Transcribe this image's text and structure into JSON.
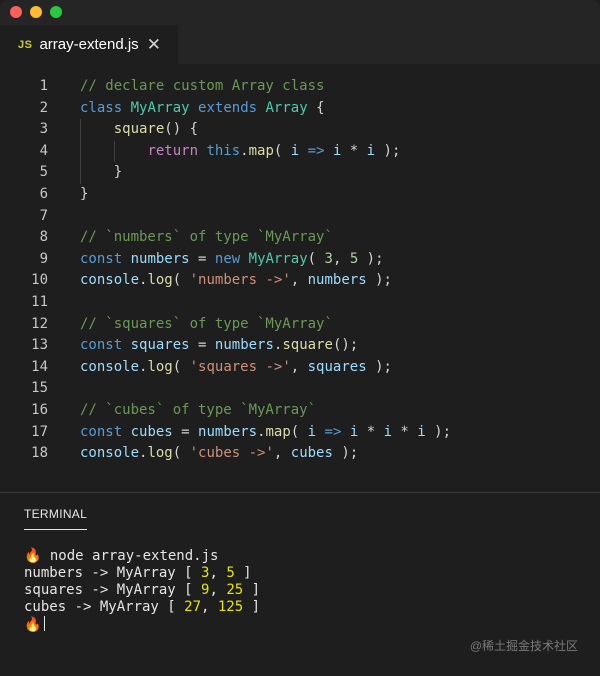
{
  "window": {
    "traffic_lights": [
      {
        "name": "close-light",
        "color": "#ff5f57"
      },
      {
        "name": "minimize-light",
        "color": "#febc2e"
      },
      {
        "name": "maximize-light",
        "color": "#28c840"
      }
    ]
  },
  "tab": {
    "icon_text": "JS",
    "filename": "array-extend.js",
    "close_glyph": "✕"
  },
  "editor": {
    "lines": [
      {
        "n": "1",
        "tokens": [
          [
            "com",
            "// declare custom Array class"
          ]
        ]
      },
      {
        "n": "2",
        "tokens": [
          [
            "kw",
            "class"
          ],
          [
            "pl",
            " "
          ],
          [
            "cls",
            "MyArray"
          ],
          [
            "pl",
            " "
          ],
          [
            "kw",
            "extends"
          ],
          [
            "pl",
            " "
          ],
          [
            "cls",
            "Array"
          ],
          [
            "pl",
            " {"
          ]
        ]
      },
      {
        "n": "3",
        "tokens": [
          [
            "pl",
            "    "
          ],
          [
            "fn",
            "square"
          ],
          [
            "pl",
            "() {"
          ]
        ]
      },
      {
        "n": "4",
        "tokens": [
          [
            "pl",
            "        "
          ],
          [
            "ctl",
            "return"
          ],
          [
            "pl",
            " "
          ],
          [
            "kw",
            "this"
          ],
          [
            "pl",
            "."
          ],
          [
            "fn",
            "map"
          ],
          [
            "pl",
            "( "
          ],
          [
            "var",
            "i"
          ],
          [
            "pl",
            " "
          ],
          [
            "kw",
            "=>"
          ],
          [
            "pl",
            " "
          ],
          [
            "var",
            "i"
          ],
          [
            "pl",
            " * "
          ],
          [
            "var",
            "i"
          ],
          [
            "pl",
            " );"
          ]
        ]
      },
      {
        "n": "5",
        "tokens": [
          [
            "pl",
            "    }"
          ]
        ]
      },
      {
        "n": "6",
        "tokens": [
          [
            "pl",
            "}"
          ]
        ]
      },
      {
        "n": "7",
        "tokens": []
      },
      {
        "n": "8",
        "tokens": [
          [
            "com",
            "// `numbers` of type `MyArray`"
          ]
        ]
      },
      {
        "n": "9",
        "tokens": [
          [
            "kw",
            "const"
          ],
          [
            "pl",
            " "
          ],
          [
            "var",
            "numbers"
          ],
          [
            "pl",
            " = "
          ],
          [
            "kw",
            "new"
          ],
          [
            "pl",
            " "
          ],
          [
            "cls",
            "MyArray"
          ],
          [
            "pl",
            "( "
          ],
          [
            "num",
            "3"
          ],
          [
            "pl",
            ", "
          ],
          [
            "num",
            "5"
          ],
          [
            "pl",
            " );"
          ]
        ]
      },
      {
        "n": "10",
        "tokens": [
          [
            "var",
            "console"
          ],
          [
            "pl",
            "."
          ],
          [
            "fn",
            "log"
          ],
          [
            "pl",
            "( "
          ],
          [
            "str",
            "'numbers ->'"
          ],
          [
            "pl",
            ", "
          ],
          [
            "var",
            "numbers"
          ],
          [
            "pl",
            " );"
          ]
        ]
      },
      {
        "n": "11",
        "tokens": []
      },
      {
        "n": "12",
        "tokens": [
          [
            "com",
            "// `squares` of type `MyArray`"
          ]
        ]
      },
      {
        "n": "13",
        "tokens": [
          [
            "kw",
            "const"
          ],
          [
            "pl",
            " "
          ],
          [
            "var",
            "squares"
          ],
          [
            "pl",
            " = "
          ],
          [
            "var",
            "numbers"
          ],
          [
            "pl",
            "."
          ],
          [
            "fn",
            "square"
          ],
          [
            "pl",
            "();"
          ]
        ]
      },
      {
        "n": "14",
        "tokens": [
          [
            "var",
            "console"
          ],
          [
            "pl",
            "."
          ],
          [
            "fn",
            "log"
          ],
          [
            "pl",
            "( "
          ],
          [
            "str",
            "'squares ->'"
          ],
          [
            "pl",
            ", "
          ],
          [
            "var",
            "squares"
          ],
          [
            "pl",
            " );"
          ]
        ]
      },
      {
        "n": "15",
        "tokens": []
      },
      {
        "n": "16",
        "tokens": [
          [
            "com",
            "// `cubes` of type `MyArray`"
          ]
        ]
      },
      {
        "n": "17",
        "tokens": [
          [
            "kw",
            "const"
          ],
          [
            "pl",
            " "
          ],
          [
            "var",
            "cubes"
          ],
          [
            "pl",
            " = "
          ],
          [
            "var",
            "numbers"
          ],
          [
            "pl",
            "."
          ],
          [
            "fn",
            "map"
          ],
          [
            "pl",
            "( "
          ],
          [
            "var",
            "i"
          ],
          [
            "pl",
            " "
          ],
          [
            "kw",
            "=>"
          ],
          [
            "pl",
            " "
          ],
          [
            "var",
            "i"
          ],
          [
            "pl",
            " * "
          ],
          [
            "var",
            "i"
          ],
          [
            "pl",
            " * "
          ],
          [
            "var",
            "i"
          ],
          [
            "pl",
            " );"
          ]
        ]
      },
      {
        "n": "18",
        "tokens": [
          [
            "var",
            "console"
          ],
          [
            "pl",
            "."
          ],
          [
            "fn",
            "log"
          ],
          [
            "pl",
            "( "
          ],
          [
            "str",
            "'cubes ->'"
          ],
          [
            "pl",
            ", "
          ],
          [
            "var",
            "cubes"
          ],
          [
            "pl",
            " );"
          ]
        ]
      }
    ]
  },
  "terminal": {
    "tab_label": "TERMINAL",
    "lines": [
      {
        "prompt_icon": "🔥",
        "parts": [
          [
            "pl",
            " node array-extend.js"
          ]
        ]
      },
      {
        "parts": [
          [
            "pl",
            "numbers -> MyArray [ "
          ],
          [
            "num",
            "3"
          ],
          [
            "pl",
            ", "
          ],
          [
            "num",
            "5"
          ],
          [
            "pl",
            " ]"
          ]
        ]
      },
      {
        "parts": [
          [
            "pl",
            "squares -> MyArray [ "
          ],
          [
            "num",
            "9"
          ],
          [
            "pl",
            ", "
          ],
          [
            "num",
            "25"
          ],
          [
            "pl",
            " ]"
          ]
        ]
      },
      {
        "parts": [
          [
            "pl",
            "cubes -> MyArray [ "
          ],
          [
            "num",
            "27"
          ],
          [
            "pl",
            ", "
          ],
          [
            "num",
            "125"
          ],
          [
            "pl",
            " ]"
          ]
        ]
      },
      {
        "prompt_icon": "🔥",
        "parts": [],
        "cursor": true
      }
    ]
  },
  "watermark": "@稀土掘金技术社区"
}
